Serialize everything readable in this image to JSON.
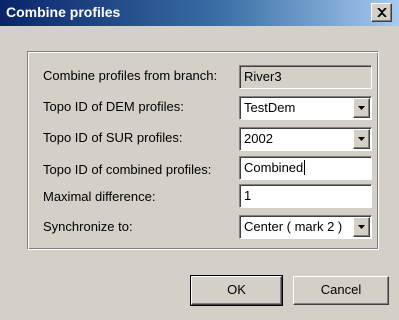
{
  "window": {
    "title": "Combine profiles",
    "close_label": "X"
  },
  "form": {
    "branch": {
      "label": "Combine profiles from branch:",
      "value": "River3"
    },
    "dem": {
      "label": "Topo ID of DEM profiles:",
      "value": "TestDem"
    },
    "sur": {
      "label": "Topo ID of SUR profiles:",
      "value": "2002"
    },
    "combined": {
      "label": "Topo ID of combined profiles:",
      "value": "Combined"
    },
    "maxdiff": {
      "label": "Maximal difference:",
      "value": "1"
    },
    "sync": {
      "label": "Synchronize to:",
      "value": "Center ( mark 2 )"
    }
  },
  "buttons": {
    "ok": "OK",
    "cancel": "Cancel"
  },
  "icons": {
    "close": "close-icon",
    "dropdown": "chevron-down-icon"
  },
  "colors": {
    "title_start": "#0a246a",
    "title_end": "#a6caf0",
    "face": "#d4d0c8"
  }
}
